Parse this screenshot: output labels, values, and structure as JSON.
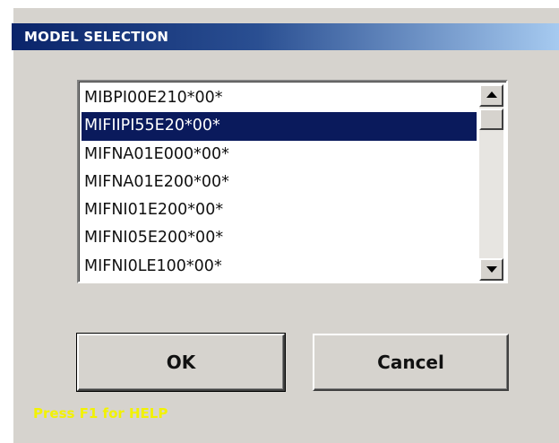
{
  "window": {
    "title": "MODEL SELECTION"
  },
  "model_list": {
    "items": [
      "MIBPI00E210*00*",
      "MIFIIPI55E20*00*",
      "MIFNA01E000*00*",
      "MIFNA01E200*00*",
      "MIFNI01E200*00*",
      "MIFNI05E200*00*",
      "MIFNI0LE100*00*"
    ],
    "selected_index": 1,
    "selected_value": "MIFIIPI55E20*00*"
  },
  "scrollbar": {
    "up_icon": "arrow-up-icon",
    "down_icon": "arrow-down-icon"
  },
  "buttons": {
    "ok_label": "OK",
    "cancel_label": "Cancel"
  },
  "footer": {
    "help_text": "Press F1 for HELP"
  },
  "colors": {
    "titlebar_start": "#0a246a",
    "titlebar_end": "#a6caf0",
    "dialog_bg": "#d6d3ce",
    "selection_bg": "#0a1a5c",
    "help_text": "#f2f200"
  }
}
